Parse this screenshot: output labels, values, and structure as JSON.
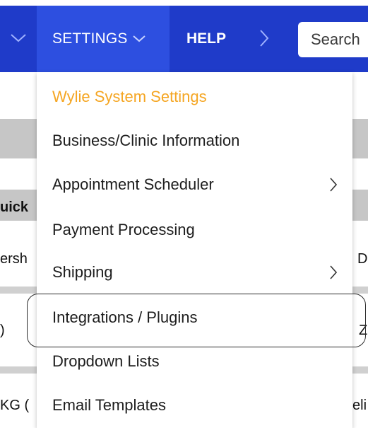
{
  "navbar": {
    "settings_label": "SETTINGS",
    "help_label": "HELP",
    "search_placeholder": "Search",
    "background_color": "#1f3bc9",
    "active_color": "#2d4fe0"
  },
  "background_fragments": {
    "quick": "uick",
    "membership": "ersh",
    "d": "D",
    "paren": ")",
    "z": "Z",
    "kg": "KG (",
    "eli": "eli"
  },
  "settings_menu": {
    "items": [
      {
        "label": "Wylie System Settings",
        "active": true
      },
      {
        "label": "Business/Clinic Information"
      },
      {
        "label": "Appointment Scheduler",
        "has_submenu": true
      },
      {
        "label": "Payment Processing"
      },
      {
        "label": "Shipping",
        "has_submenu": true
      },
      {
        "label": "Integrations / Plugins",
        "highlighted": true
      },
      {
        "label": "Dropdown Lists"
      },
      {
        "label": "Email Templates"
      }
    ],
    "active_color": "#f5a623"
  }
}
